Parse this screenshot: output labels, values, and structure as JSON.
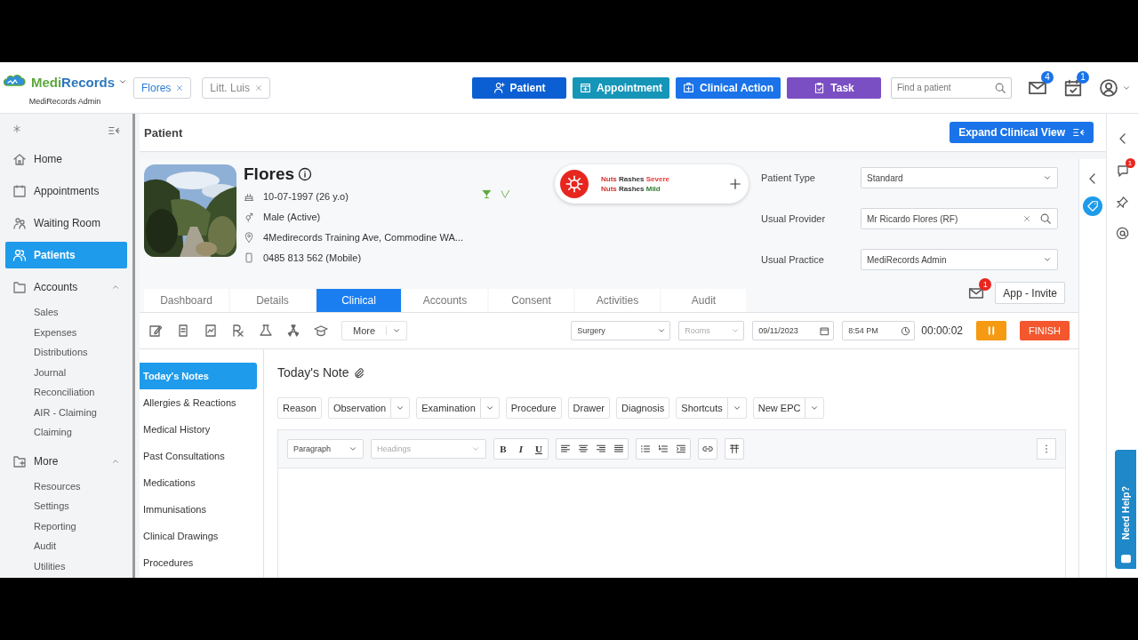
{
  "logo": {
    "name": "MediRecords",
    "subtitle": "MediRecords Admin"
  },
  "open_tabs": [
    {
      "label": "Flores",
      "selected": true
    },
    {
      "label": "Litt. Luis",
      "selected": false
    }
  ],
  "actions": [
    {
      "label": "Patient",
      "color": "#0b5fd3"
    },
    {
      "label": "Appointment",
      "color": "#1595b8"
    },
    {
      "label": "Clinical Action",
      "color": "#1a73e8"
    },
    {
      "label": "Task",
      "color": "#7a4fc4"
    }
  ],
  "search": {
    "placeholder": "Find a patient"
  },
  "notifications": [
    {
      "kind": "mail",
      "count": "4"
    },
    {
      "kind": "tasks",
      "count": "1"
    }
  ],
  "sidebar": {
    "items": [
      {
        "label": "Home",
        "selected": false
      },
      {
        "label": "Appointments",
        "selected": false
      },
      {
        "label": "Waiting Room",
        "selected": false
      },
      {
        "label": "Patients",
        "selected": true
      },
      {
        "label": "Accounts",
        "selected": false,
        "expanded": true,
        "children": [
          {
            "label": "Sales",
            "selected": false
          },
          {
            "label": "Expenses",
            "selected": false
          },
          {
            "label": "Distributions",
            "selected": false
          },
          {
            "label": "Journal",
            "selected": false
          },
          {
            "label": "Reconciliation",
            "selected": false
          },
          {
            "label": "AIR - Claiming",
            "selected": false
          },
          {
            "label": "Claiming",
            "selected": false
          }
        ]
      },
      {
        "label": "More",
        "selected": false,
        "expanded": true,
        "children": [
          {
            "label": "Resources",
            "selected": false
          },
          {
            "label": "Settings",
            "selected": false
          },
          {
            "label": "Reporting",
            "selected": false
          },
          {
            "label": "Audit",
            "selected": false
          },
          {
            "label": "Utilities",
            "selected": false
          }
        ]
      }
    ]
  },
  "page_title": "Patient",
  "expand_button": "Expand Clinical View",
  "patient": {
    "name": "Flores",
    "dob": "10-07-1997 (26 y.o)",
    "gender": "Male (Active)",
    "address": "4Medirecords Training Ave, Commodine WA...",
    "phone": "0485 813 562 (Mobile)"
  },
  "allergies": [
    {
      "substance": "Nuts",
      "reaction": "Rashes",
      "severity": "Severe",
      "color": "#e53935"
    },
    {
      "substance": "Nuts",
      "reaction": "Rashes",
      "severity": "Mild",
      "color": "#2e7d32"
    }
  ],
  "fields": [
    {
      "label": "Patient Type",
      "value": "Standard",
      "kind": "select"
    },
    {
      "label": "Usual Provider",
      "value": "Mr Ricardo Flores (RF)",
      "kind": "search"
    },
    {
      "label": "Usual Practice",
      "value": "MediRecords Admin",
      "kind": "select"
    }
  ],
  "invite": {
    "count": "1",
    "button": "App - Invite"
  },
  "tabs": [
    {
      "label": "Dashboard",
      "selected": false
    },
    {
      "label": "Details",
      "selected": false
    },
    {
      "label": "Clinical",
      "selected": true
    },
    {
      "label": "Accounts",
      "selected": false
    },
    {
      "label": "Consent",
      "selected": false
    },
    {
      "label": "Activities",
      "selected": false
    },
    {
      "label": "Audit",
      "selected": false
    }
  ],
  "toolbar": {
    "more": "More",
    "location": "Surgery",
    "rooms_placeholder": "Rooms",
    "date": "09/11/2023",
    "time": "8:54 PM",
    "timer": "00:00:02",
    "finish": "FINISH"
  },
  "clinical_menu": [
    {
      "label": "Today's Notes",
      "selected": true
    },
    {
      "label": "Allergies & Reactions",
      "selected": false
    },
    {
      "label": "Medical History",
      "selected": false
    },
    {
      "label": "Past Consultations",
      "selected": false
    },
    {
      "label": "Medications",
      "selected": false
    },
    {
      "label": "Immunisations",
      "selected": false
    },
    {
      "label": "Clinical Drawings",
      "selected": false
    },
    {
      "label": "Procedures",
      "selected": false
    }
  ],
  "note": {
    "title": "Today's Note",
    "sections": [
      {
        "label": "Reason",
        "dropdown": false
      },
      {
        "label": "Observation",
        "dropdown": true
      },
      {
        "label": "Examination",
        "dropdown": true
      },
      {
        "label": "Procedure",
        "dropdown": false
      },
      {
        "label": "Drawer",
        "dropdown": false
      },
      {
        "label": "Diagnosis",
        "dropdown": false
      },
      {
        "label": "Shortcuts",
        "dropdown": true
      },
      {
        "label": "New EPC",
        "dropdown": true
      }
    ],
    "paragraph": "Paragraph",
    "headings_placeholder": "Headings",
    "format_buttons": [
      "B",
      "I",
      "U"
    ]
  },
  "rail": {
    "chat_count": "1"
  },
  "help": "Need Help?"
}
